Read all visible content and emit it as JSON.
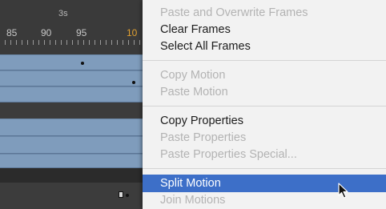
{
  "timeline": {
    "ruler": {
      "seconds_label": "3s",
      "frame_numbers": [
        "85",
        "90",
        "95",
        "10"
      ]
    }
  },
  "context_menu": {
    "items": [
      {
        "label": "Paste and Overwrite Frames",
        "enabled": false,
        "selected": false
      },
      {
        "label": "Clear Frames",
        "enabled": true,
        "selected": false
      },
      {
        "label": "Select All Frames",
        "enabled": true,
        "selected": false
      },
      {
        "label": "Copy Motion",
        "enabled": false,
        "selected": false
      },
      {
        "label": "Paste Motion",
        "enabled": false,
        "selected": false
      },
      {
        "label": "Copy Properties",
        "enabled": true,
        "selected": false
      },
      {
        "label": "Paste Properties",
        "enabled": false,
        "selected": false
      },
      {
        "label": "Paste Properties Special...",
        "enabled": false,
        "selected": false
      },
      {
        "label": "Split Motion",
        "enabled": true,
        "selected": true
      },
      {
        "label": "Join Motions",
        "enabled": false,
        "selected": false
      }
    ]
  },
  "colors": {
    "menu_background": "#f2f2f2",
    "highlight": "#3d6fc8",
    "disabled_text": "#b3b3b3",
    "tween_track": "#7f9cbc",
    "timeline_background": "#2a2a2a"
  },
  "icons": {
    "pointer": "arrow-cursor-icon"
  }
}
